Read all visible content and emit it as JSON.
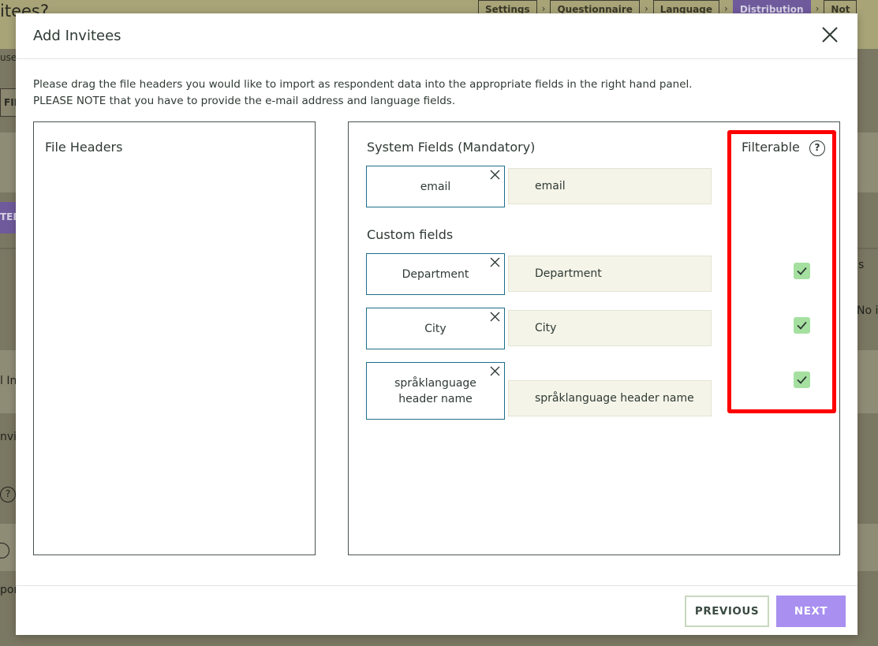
{
  "background": {
    "page_title": "itees?",
    "subtitle": "use",
    "steps": [
      {
        "label": "Settings"
      },
      {
        "label": "Questionnaire"
      },
      {
        "label": "Language"
      },
      {
        "label": "Distribution"
      },
      {
        "label": "Not"
      }
    ],
    "filter_tab": "FIL",
    "invitees_tab": "TEE",
    "side_texts": {
      "col_s": "s",
      "no_items": "No i",
      "all_invitees": "l In",
      "invite": "nvi",
      "help1": "?",
      "export": "por"
    }
  },
  "modal": {
    "title": "Add Invitees",
    "instructions": [
      "Please drag the file headers you would like to import as respondent data into the appropriate fields in the right hand panel.",
      "PLEASE NOTE that you have to provide the e-mail address and language fields."
    ],
    "file_headers_title": "File Headers",
    "system_fields_title": "System Fields (Mandatory)",
    "custom_fields_title": "Custom fields",
    "filterable_title": "Filterable",
    "filterable_help": "?",
    "system_fields": [
      {
        "header": "email",
        "target": "email"
      }
    ],
    "custom_fields": [
      {
        "header": "Department",
        "target": "Department",
        "filterable": true
      },
      {
        "header": "City",
        "target": "City",
        "filterable": true
      },
      {
        "header": "språklanguage header name",
        "target": "språklanguage header name",
        "filterable": true
      }
    ],
    "buttons": {
      "previous": "PREVIOUS",
      "next": "NEXT"
    }
  },
  "colors": {
    "accent_purple": "#a88ff0",
    "chip_border": "#1d6e8a",
    "checkbox_green": "#a6e0a1",
    "highlight_red": "#ff0000"
  }
}
